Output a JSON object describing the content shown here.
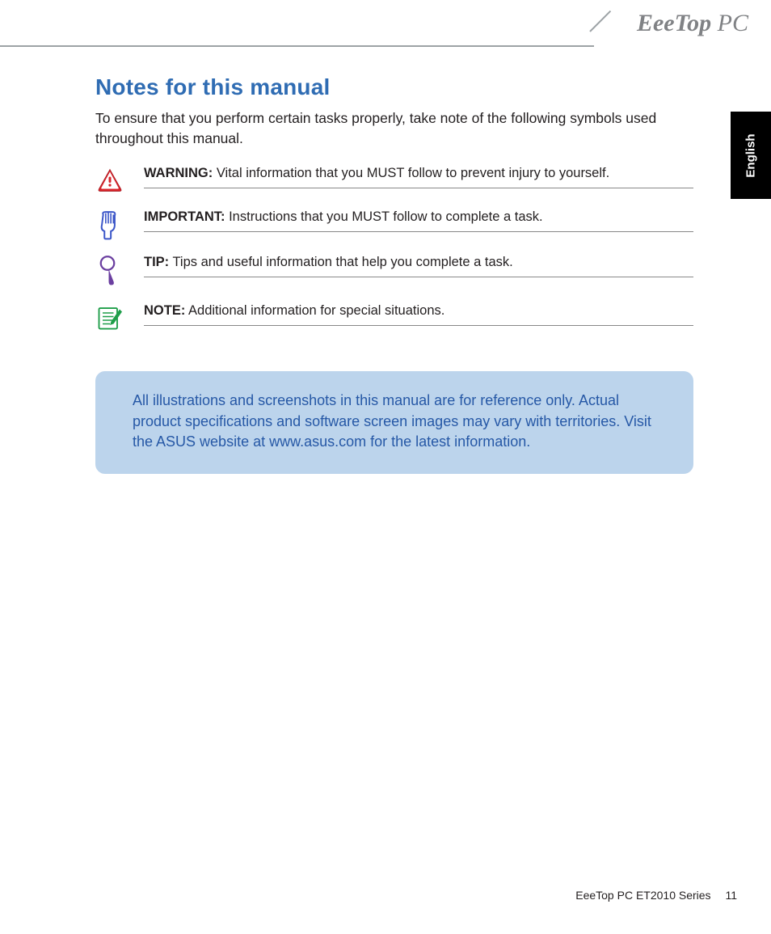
{
  "brand": "EeeTop PC",
  "language_tab": "English",
  "heading": "Notes for this manual",
  "intro": "To ensure that you perform certain tasks properly, take note of the following symbols used throughout this manual.",
  "symbols": {
    "warning": {
      "label": "WARNING:",
      "text": " Vital information that you MUST follow to prevent injury to yourself."
    },
    "important": {
      "label": "IMPORTANT:",
      "text": " Instructions that you MUST follow to complete a task."
    },
    "tip": {
      "label": "TIP:",
      "text": " Tips and useful information that help you complete a task."
    },
    "note": {
      "label": "NOTE:",
      "text": " Additional information for special situations."
    }
  },
  "callout": "All illustrations and screenshots in this manual are for reference only. Actual product specifications and software screen images may vary with territories. Visit the ASUS website at www.asus.com for the latest information.",
  "footer": {
    "series": "EeeTop PC ET2010 Series",
    "page": "11"
  }
}
